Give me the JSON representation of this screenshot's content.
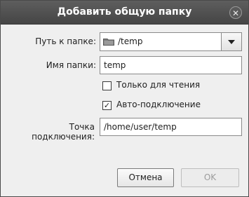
{
  "dialog": {
    "title": "Добавить общую папку",
    "close_glyph": "✕",
    "folder_path": {
      "label": "Путь к папке:",
      "value": "/temp",
      "icon": "folder-icon"
    },
    "folder_name": {
      "label": "Имя папки:",
      "value": "temp"
    },
    "read_only": {
      "label": "Только для чтения",
      "checked": false
    },
    "auto_mount": {
      "label": "Авто-подключение",
      "checked": true,
      "check_glyph": "✓"
    },
    "mount_point": {
      "label": "Точка подключения:",
      "value": "/home/user/temp"
    },
    "buttons": {
      "cancel": "Отмена",
      "ok": "OK"
    }
  }
}
